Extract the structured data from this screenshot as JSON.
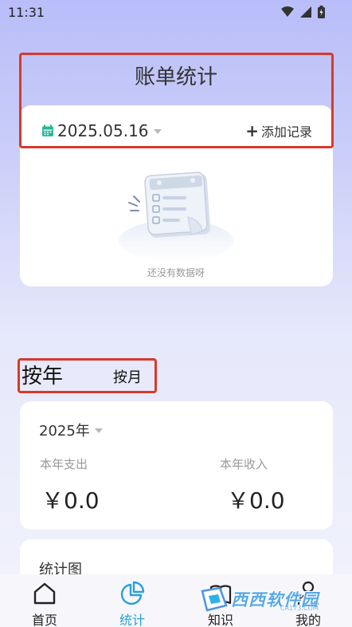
{
  "status_bar": {
    "time": "11:31"
  },
  "header": {
    "title": "账单统计"
  },
  "summary": {
    "date": "2025.05.16",
    "add_record_label": "添加记录",
    "empty_text": "还没有数据呀"
  },
  "period_tabs": {
    "by_year": "按年",
    "by_month": "按月"
  },
  "year_card": {
    "year": "2025年",
    "expense_label": "本年支出",
    "income_label": "本年收入",
    "expense_value": "￥0.0",
    "income_value": "￥0.0"
  },
  "chart_card": {
    "title": "统计图"
  },
  "tabbar": {
    "items": [
      {
        "label": "首页",
        "icon": "home-icon"
      },
      {
        "label": "统计",
        "icon": "pie-chart-icon",
        "active": true
      },
      {
        "label": "知识",
        "icon": "book-icon"
      },
      {
        "label": "我的",
        "icon": "person-icon"
      }
    ]
  },
  "watermark": {
    "text": "西西软件园",
    "sub": "CR173.COM"
  },
  "colors": {
    "accent": "#2aa0d6",
    "highlight": "#d63a2e",
    "background_top": "#b9bdf9",
    "calendar_icon": "#2bb59a"
  }
}
